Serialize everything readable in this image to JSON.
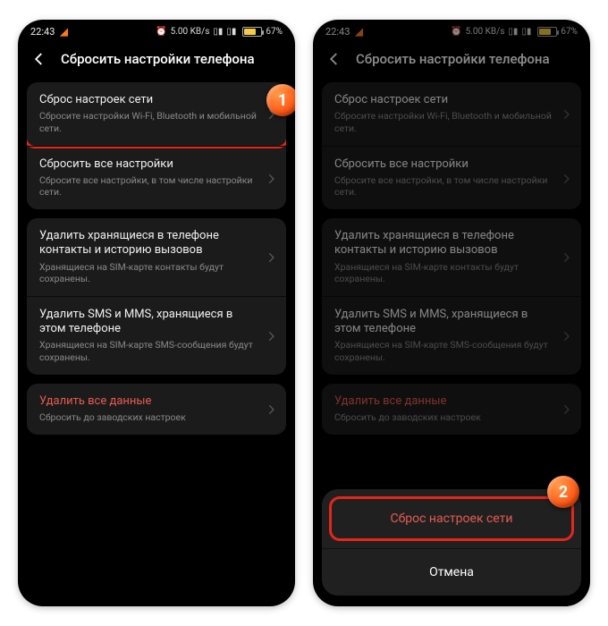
{
  "statusbar": {
    "time": "22:43",
    "battery_pct": "67%",
    "net": "5.00 KB/s"
  },
  "page": {
    "title": "Сбросить настройки телефона"
  },
  "group1": [
    {
      "title": "Сброс настроек сети",
      "sub": "Сбросите настройки Wi-Fi, Bluetooth и мобильной сети."
    },
    {
      "title": "Сбросить все настройки",
      "sub": "Сбросите все настройки, в том числе настройки сети."
    }
  ],
  "group2": [
    {
      "title": "Удалить хранящиеся в телефоне контакты и историю вызовов",
      "sub": "Хранящиеся на SIM-карте контакты будут сохранены."
    },
    {
      "title": "Удалить SMS и MMS, хранящиеся в этом телефоне",
      "sub": "Хранящиеся на SIM-карте SMS-сообщения будут сохранены."
    }
  ],
  "group3": [
    {
      "title": "Удалить все данные",
      "sub": "Сбросить до заводских настроек"
    }
  ],
  "sheet": {
    "confirm": "Сброс настроек сети",
    "cancel": "Отмена"
  },
  "markers": {
    "m1": "1",
    "m2": "2"
  }
}
